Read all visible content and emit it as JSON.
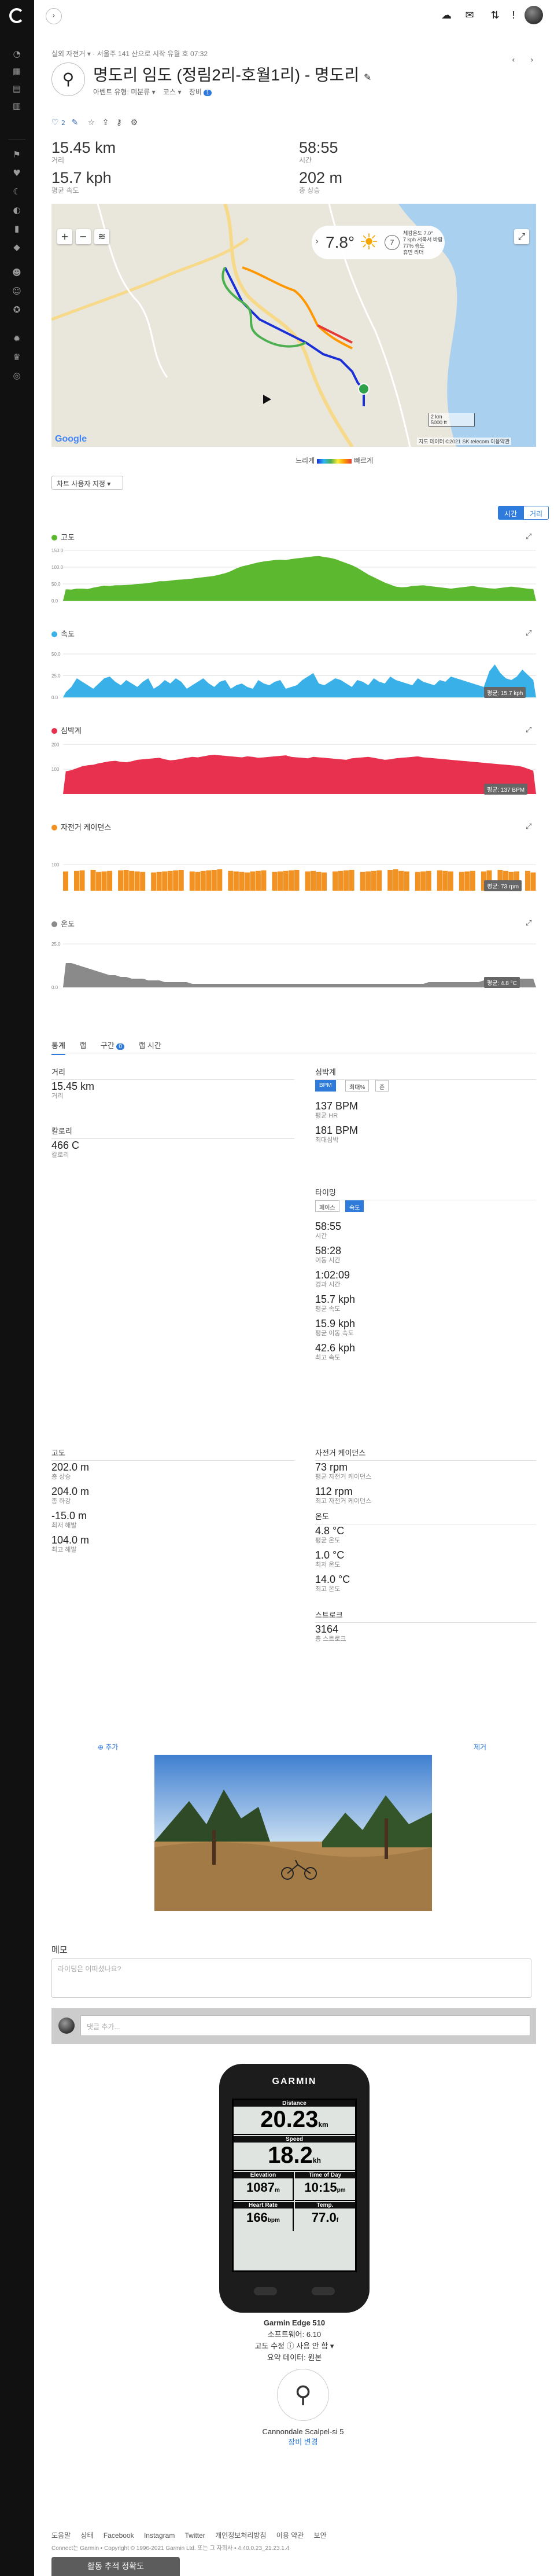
{
  "breadcrumb": [
    "실외 자전거",
    "서울주 141 산으로 시작 유월 호 07:32"
  ],
  "activity": {
    "title": "명도리 임도 (정림2리-호월1리) - 명도리",
    "sub": [
      "아벤트 유형: 미분류",
      "코스",
      "장비"
    ],
    "sub_badge": "1"
  },
  "social": {
    "likes": "2"
  },
  "summary": [
    {
      "value": "15.45 km",
      "label": "거리"
    },
    {
      "value": "58:55",
      "label": "시간"
    },
    {
      "value": "15.7 kph",
      "label": "평균 속도"
    },
    {
      "value": "202 m",
      "label": "총 상승"
    }
  ],
  "weather": {
    "temp": "7.8°",
    "wind_speed": "7",
    "lines": [
      "체감온도 7.0°",
      "7 kph 서북서 바람",
      "77% 습도",
      "휴먼 리더"
    ]
  },
  "map": {
    "scale_top": "2 km",
    "scale_bottom": "5000 ft",
    "attribution": "지도 데이터 ©2021 SK telecom   이용약관",
    "google": "Google"
  },
  "speed_legend": {
    "slow": "느리게",
    "fast": "빠르게"
  },
  "chart_settings_btn": "차트 사용자 지정",
  "x_toggle": {
    "time": "시간",
    "distance": "거리"
  },
  "chart_data": [
    {
      "type": "area",
      "title": "고도",
      "color": "#5cb82e",
      "ylim": [
        0,
        155
      ],
      "yticks": [
        "150.0",
        "100.0",
        "50.0",
        "0.0"
      ],
      "values": [
        34,
        33,
        36,
        36,
        35,
        39,
        42,
        45,
        44,
        46,
        46,
        47,
        48,
        50,
        51,
        53,
        55,
        58,
        58,
        60,
        62,
        63,
        64,
        66,
        68,
        70,
        72,
        74,
        78,
        82,
        88,
        96,
        102,
        106,
        110,
        114,
        117,
        119,
        121,
        122,
        121,
        124,
        126,
        128,
        130,
        132,
        133,
        130,
        128,
        124,
        118,
        112,
        106,
        98,
        88,
        78,
        70,
        62,
        54,
        48,
        42,
        40,
        41,
        44,
        45,
        46,
        44,
        42,
        40,
        38,
        36,
        38,
        40,
        42,
        44,
        41,
        39,
        37,
        36,
        38,
        40,
        42,
        40,
        38,
        36,
        35
      ]
    },
    {
      "type": "area",
      "title": "속도",
      "color": "#39b0e8",
      "ylim": [
        0,
        60
      ],
      "yticks": [
        "50.0",
        "25.0",
        "0.0"
      ],
      "badge": "평균: 15.7 kph",
      "values": [
        6,
        12,
        22,
        18,
        14,
        10,
        16,
        22,
        24,
        18,
        14,
        20,
        16,
        12,
        18,
        22,
        10,
        14,
        20,
        16,
        22,
        18,
        10,
        14,
        18,
        22,
        16,
        12,
        18,
        20,
        10,
        14,
        16,
        12,
        10,
        20,
        16,
        14,
        18,
        20,
        10,
        12,
        14,
        20,
        24,
        28,
        16,
        14,
        18,
        22,
        20,
        16,
        12,
        20,
        18,
        14,
        22,
        18,
        16,
        24,
        20,
        18,
        16,
        14,
        22,
        18,
        16,
        14,
        20,
        18,
        24,
        22,
        20,
        18,
        16,
        14,
        12,
        30,
        38,
        28,
        22,
        20,
        24,
        32,
        26,
        20
      ]
    },
    {
      "type": "area",
      "title": "심박계",
      "color": "#e8304f",
      "ylim": [
        0,
        210
      ],
      "yticks": [
        "200",
        "100"
      ],
      "badge": "평균: 137 BPM",
      "values": [
        92,
        96,
        104,
        112,
        116,
        118,
        124,
        128,
        132,
        134,
        130,
        128,
        132,
        138,
        140,
        142,
        144,
        146,
        140,
        136,
        138,
        142,
        146,
        150,
        148,
        152,
        156,
        158,
        156,
        154,
        152,
        150,
        148,
        152,
        150,
        146,
        148,
        150,
        152,
        154,
        156,
        150,
        148,
        146,
        144,
        150,
        148,
        146,
        144,
        142,
        140,
        138,
        144,
        146,
        148,
        150,
        146,
        142,
        138,
        140,
        144,
        146,
        148,
        150,
        152,
        148,
        146,
        144,
        142,
        140,
        138,
        136,
        134,
        132,
        130,
        128,
        126,
        124,
        122,
        120,
        118,
        116,
        114,
        110,
        102,
        94
      ]
    },
    {
      "type": "bar",
      "title": "자전거 케이던스",
      "color": "#f19222",
      "ylim": [
        0,
        200
      ],
      "yticks": [
        "100"
      ],
      "badge": "평균: 73 rpm",
      "values": [
        74,
        0,
        76,
        78,
        0,
        80,
        72,
        74,
        76,
        0,
        78,
        80,
        76,
        74,
        72,
        0,
        70,
        72,
        74,
        76,
        78,
        80,
        0,
        74,
        72,
        76,
        78,
        80,
        82,
        0,
        76,
        74,
        72,
        70,
        74,
        76,
        78,
        0,
        72,
        74,
        76,
        78,
        80,
        0,
        74,
        76,
        72,
        70,
        0,
        74,
        76,
        78,
        80,
        0,
        72,
        74,
        76,
        78,
        0,
        80,
        82,
        76,
        74,
        0,
        72,
        74,
        76,
        0,
        78,
        76,
        74,
        0,
        72,
        74,
        76,
        0,
        74,
        78,
        0,
        80,
        76,
        72,
        74,
        0,
        76,
        70
      ]
    },
    {
      "type": "area",
      "title": "온도",
      "color": "#8a8a8a",
      "ylim": [
        0,
        30
      ],
      "yticks": [
        "25.0",
        "0.0"
      ],
      "badge": "평균: 4.8 °C",
      "values": [
        14,
        14,
        13,
        12,
        11,
        10,
        9,
        8,
        7,
        7,
        6,
        6,
        5,
        5,
        5,
        4,
        4,
        4,
        3,
        3,
        3,
        3,
        3,
        2,
        2,
        2,
        2,
        2,
        2,
        2,
        2,
        2,
        2,
        2,
        2,
        2,
        2,
        2,
        2,
        2,
        2,
        2,
        2,
        2,
        2,
        2,
        2,
        2,
        2,
        2,
        2,
        2,
        2,
        2,
        2,
        2,
        2,
        2,
        2,
        2,
        2,
        2,
        2,
        2,
        2,
        2,
        3,
        3,
        3,
        3,
        3,
        3,
        3,
        3,
        3,
        3,
        4,
        4,
        4,
        4,
        4,
        5,
        5,
        5,
        5,
        5
      ]
    }
  ],
  "tabs": [
    {
      "label": "통계"
    },
    {
      "label": "랩"
    },
    {
      "label": "구간",
      "badge": "0"
    },
    {
      "label": "랩 시간"
    }
  ],
  "stats": {
    "distance": {
      "head": "거리",
      "items": [
        {
          "v": "15.45 km",
          "l": "거리"
        }
      ]
    },
    "calories": {
      "head": "칼로리",
      "items": [
        {
          "v": "466 C",
          "l": "칼로리"
        }
      ]
    },
    "heart": {
      "head": "심박계",
      "toggles": [
        "BPM",
        "최대%",
        "존"
      ],
      "items": [
        {
          "v": "137 BPM",
          "l": "평균 HR"
        },
        {
          "v": "181 BPM",
          "l": "최대심박"
        }
      ]
    },
    "timing": {
      "head": "타이밍",
      "toggles": [
        "페이스",
        "속도"
      ],
      "items": [
        {
          "v": "58:55",
          "l": "시간"
        },
        {
          "v": "58:28",
          "l": "이동 시간"
        },
        {
          "v": "1:02:09",
          "l": "경과 시간"
        },
        {
          "v": "15.7 kph",
          "l": "평균 속도"
        },
        {
          "v": "15.9 kph",
          "l": "평균 이동 속도"
        },
        {
          "v": "42.6 kph",
          "l": "최고 속도"
        }
      ]
    },
    "elevation": {
      "head": "고도",
      "items": [
        {
          "v": "202.0 m",
          "l": "총 상승"
        },
        {
          "v": "204.0 m",
          "l": "총 하강"
        },
        {
          "v": "-15.0 m",
          "l": "최저 해발"
        },
        {
          "v": "104.0 m",
          "l": "최고 해발"
        }
      ]
    },
    "cadence": {
      "head": "자전거 케이던스",
      "items": [
        {
          "v": "73 rpm",
          "l": "평균 자전거 케이던스"
        },
        {
          "v": "112 rpm",
          "l": "최고 자전거 케이던스"
        }
      ]
    },
    "temperature": {
      "head": "온도",
      "items": [
        {
          "v": "4.8 °C",
          "l": "평균 온도"
        },
        {
          "v": "1.0 °C",
          "l": "최저 온도"
        },
        {
          "v": "14.0 °C",
          "l": "최고 온도"
        }
      ]
    },
    "strokes": {
      "head": "스트로크",
      "items": [
        {
          "v": "3164",
          "l": "총 스트로크"
        }
      ]
    }
  },
  "photo_links": {
    "add": "추가",
    "remove": "제거"
  },
  "notes": {
    "title": "메모",
    "placeholder": "라이딩은 어떠셨나요?"
  },
  "comment": {
    "placeholder": "댓글 추가..."
  },
  "device": {
    "brand": "GARMIN",
    "screen": {
      "distance": {
        "label": "Distance",
        "value": "20.23",
        "unit": "km"
      },
      "speed": {
        "label": "Speed",
        "value": "18.2",
        "unit": "kh"
      },
      "elevation": {
        "label": "Elevation",
        "value": "1087",
        "unit": "m"
      },
      "time": {
        "label": "Time of Day",
        "value": "10:15",
        "unit": "pm"
      },
      "hr": {
        "label": "Heart Rate",
        "value": "166",
        "unit": "bpm"
      },
      "temp": {
        "label": "Temp.",
        "value": "77.0",
        "unit": "f"
      }
    },
    "name": "Garmin Edge 510",
    "software": "소프트웨어: 6.10",
    "elev_corr": "고도 수정 ⓘ  사용 안 함 ▾",
    "source": "요약 데이터: 원본"
  },
  "gear": {
    "name": "Cannondale Scalpel-si 5",
    "link": "장비 변경"
  },
  "footer": {
    "links": [
      "도움말",
      "상태",
      "Facebook",
      "Instagram",
      "Twitter",
      "개인정보처리방침",
      "이용 약관",
      "보안"
    ],
    "copyright": "Connect는 Garmin • Copyright © 1996-2021 Garmin Ltd. 또는 그 자회사 • 4.40.0.23_21.23.1.4",
    "feedback": "활동 추적 정확도"
  }
}
